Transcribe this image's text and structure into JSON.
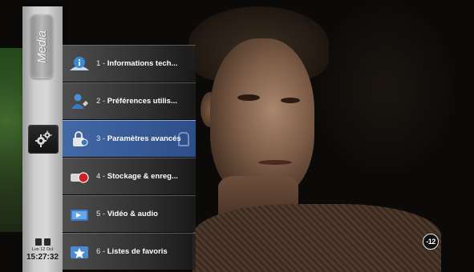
{
  "sidebar": {
    "media_label": "Media"
  },
  "menu": {
    "items": [
      {
        "number": "1 -",
        "label": "Informations tech...",
        "icon": "info-icon"
      },
      {
        "number": "2 -",
        "label": "Préférences utilis...",
        "icon": "user-icon"
      },
      {
        "number": "3 -",
        "label": "Paramètres avancés",
        "icon": "advanced-settings-icon",
        "active": true
      },
      {
        "number": "4 -",
        "label": "Stockage & enreg...",
        "icon": "storage-record-icon"
      },
      {
        "number": "5 -",
        "label": "Vidéo & audio",
        "icon": "video-audio-icon"
      },
      {
        "number": "6 -",
        "label": "Listes de favoris",
        "icon": "favorites-icon"
      }
    ]
  },
  "status": {
    "date": "Lun 12 Oct",
    "time": "15:27:32"
  },
  "video": {
    "age_rating": "-12"
  },
  "colors": {
    "active_item": "#4a6ea8",
    "sidebar": "#cfcfcf"
  }
}
